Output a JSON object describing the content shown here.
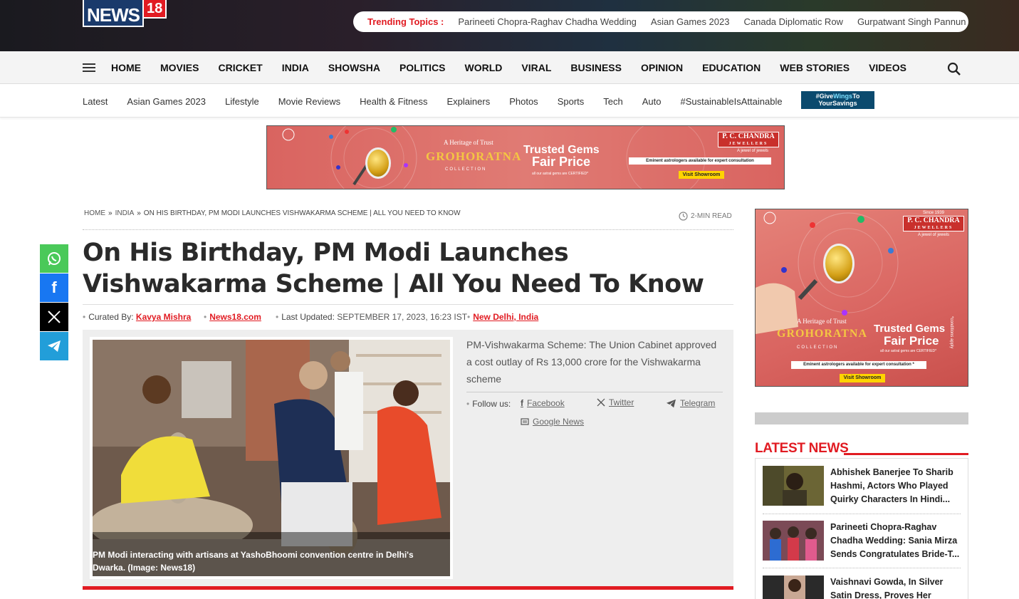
{
  "header": {
    "logo_text": "NEWS",
    "logo_num": "18",
    "trending_label": "Trending Topics :",
    "trending": [
      "Parineeti Chopra-Raghav Chadha Wedding",
      "Asian Games 2023",
      "Canada Diplomatic Row",
      "Gurpatwant Singh Pannun"
    ]
  },
  "nav": {
    "items": [
      "HOME",
      "MOVIES",
      "CRICKET",
      "INDIA",
      "SHOWSHA",
      "POLITICS",
      "WORLD",
      "VIRAL",
      "BUSINESS",
      "OPINION",
      "EDUCATION",
      "WEB STORIES",
      "VIDEOS"
    ]
  },
  "subnav": {
    "items": [
      "Latest",
      "Asian Games 2023",
      "Lifestyle",
      "Movie Reviews",
      "Health & Fitness",
      "Explainers",
      "Photos",
      "Sports",
      "Tech",
      "Auto",
      "#SustainableIsAttainable"
    ],
    "promo_line1": "#Give",
    "promo_wings": "Wings",
    "promo_to": "To",
    "promo_line2": "YourSavings"
  },
  "ad": {
    "heritage": "A Heritage of Trust",
    "brand": "GROHORATNA",
    "collection": "COLLECTION",
    "trusted": "Trusted Gems",
    "fair": "Fair Price",
    "certified": "all our astral gems are CERTIFIED*",
    "jeweller": "P. C. CHANDRA",
    "jeweller_sub": "JEWELLERS",
    "jewel_tag": "A jewel of jewels",
    "since": "Since 1939",
    "eminent": "Eminent astrologers available for expert consultation",
    "eminent_side": "Eminent astrologers available for expert consultation *",
    "visit": "Visit Showroom",
    "conditions": "*conditions apply"
  },
  "breadcrumb": {
    "home": "HOME",
    "section": "INDIA",
    "current": "ON HIS BIRTHDAY, PM MODI LAUNCHES VISHWAKARMA SCHEME | ALL YOU NEED TO KNOW",
    "read_time": "2-MIN READ"
  },
  "article": {
    "headline": "On His Birthday, PM Modi Launches Vishwakarma Scheme | All You Need To Know",
    "curated_label": "Curated By:",
    "author": "Kavya Mishra",
    "source": "News18.com",
    "updated_label": "Last Updated:",
    "updated": "SEPTEMBER 17, 2023, 16:23 IST",
    "location": "New Delhi, India",
    "caption": "PM Modi interacting with artisans at YashoBhoomi convention centre in Delhi's Dwarka. (Image: News18)",
    "summary": "PM-Vishwakarma Scheme: The Union Cabinet approved a cost outlay of Rs 13,000 crore for the Vishwakarma scheme",
    "follow_label": "Follow us:",
    "follow": [
      "Facebook",
      "Twitter",
      "Telegram",
      "Google News"
    ]
  },
  "latest": {
    "title": "LATEST NEWS",
    "items": [
      "Abhishek Banerjee To Sharib Hashmi, Actors Who Played Quirky Characters In Hindi...",
      "Parineeti Chopra-Raghav Chadha Wedding: Sania Mirza Sends Congratulates Bride-T...",
      "Vaishnavi Gowda, In Silver Satin Dress, Proves Her"
    ]
  },
  "colors": {
    "accent": "#e11b22",
    "nav_bg": "#f4f4f4",
    "ad_bg": "#d96460",
    "logo_blue": "#1a3a6b"
  }
}
